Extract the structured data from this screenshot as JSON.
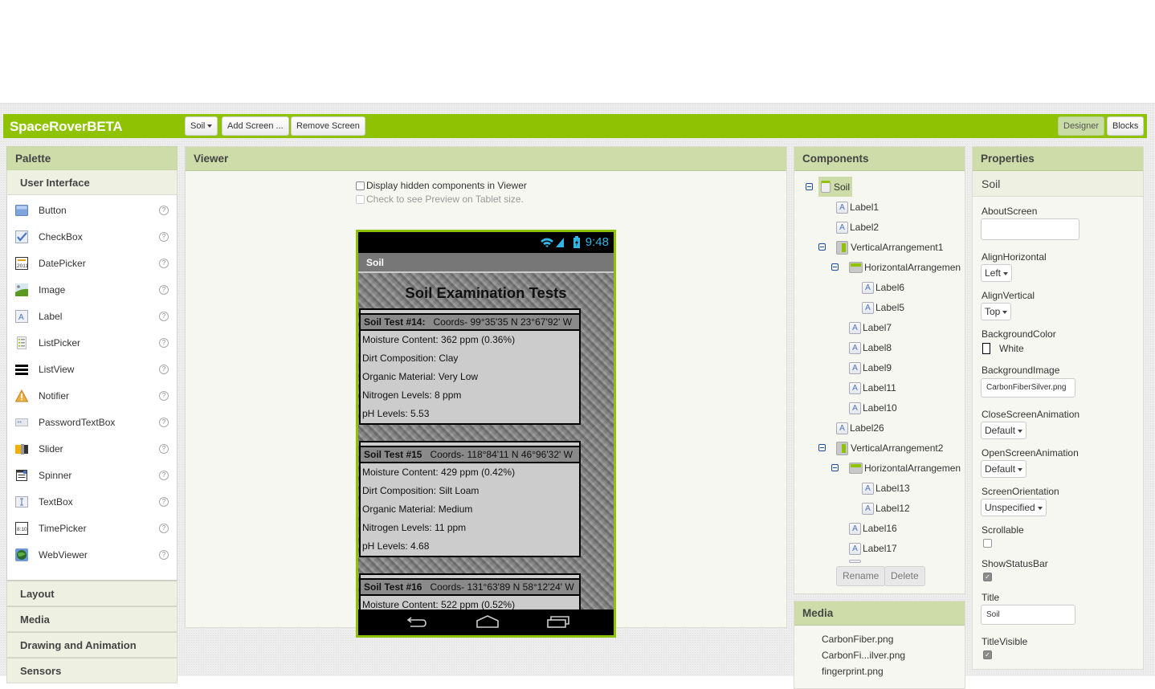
{
  "app": {
    "title": "SpaceRoverBETA"
  },
  "toolbar": {
    "screen_select": "Soil",
    "add_screen": "Add Screen ...",
    "remove_screen": "Remove Screen",
    "designer": "Designer",
    "blocks": "Blocks"
  },
  "palette": {
    "title": "Palette",
    "section": "User Interface",
    "items": [
      {
        "label": "Button",
        "icon": "button-icon"
      },
      {
        "label": "CheckBox",
        "icon": "checkbox-icon"
      },
      {
        "label": "DatePicker",
        "icon": "datepicker-icon"
      },
      {
        "label": "Image",
        "icon": "image-icon"
      },
      {
        "label": "Label",
        "icon": "label-icon"
      },
      {
        "label": "ListPicker",
        "icon": "listpicker-icon"
      },
      {
        "label": "ListView",
        "icon": "listview-icon"
      },
      {
        "label": "Notifier",
        "icon": "notifier-icon"
      },
      {
        "label": "PasswordTextBox",
        "icon": "password-icon"
      },
      {
        "label": "Slider",
        "icon": "slider-icon"
      },
      {
        "label": "Spinner",
        "icon": "spinner-icon"
      },
      {
        "label": "TextBox",
        "icon": "textbox-icon"
      },
      {
        "label": "TimePicker",
        "icon": "timepicker-icon"
      },
      {
        "label": "WebViewer",
        "icon": "webviewer-icon"
      }
    ],
    "help_glyph": "?",
    "categories": [
      "Layout",
      "Media",
      "Drawing and Animation",
      "Sensors"
    ]
  },
  "viewer": {
    "title": "Viewer",
    "display_hidden": "Display hidden components in Viewer",
    "tablet_preview": "Check to see Preview on Tablet size.",
    "phone": {
      "clock": "9:48",
      "screen_title": "Soil",
      "heading": "Soil Examination Tests",
      "tests": [
        {
          "name": "Soil Test #14:",
          "coords": "Coords- 99°35'35 N 23°67'92' W",
          "lines": [
            "Moisture Content: 362 ppm (0.36%)",
            "Dirt Composition: Clay",
            "Organic Material: Very Low",
            "Nitrogen Levels: 8 ppm",
            "pH Levels: 5.53"
          ]
        },
        {
          "name": "Soil Test #15",
          "coords": "Coords- 118°84'11 N 46°96'32' W",
          "lines": [
            "Moisture Content: 429 ppm (0.42%)",
            "Dirt Composition: Silt Loam",
            "Organic Material: Medium",
            "Nitrogen Levels: 11 ppm",
            "pH Levels: 4.68"
          ]
        },
        {
          "name": "Soil Test #16",
          "coords": "Coords- 131°63'89 N 58°12'24' W",
          "lines": [
            "Moisture Content: 522 ppm (0.52%)"
          ]
        }
      ]
    }
  },
  "components": {
    "title": "Components",
    "tree": [
      {
        "label": "Soil",
        "type": "screen"
      },
      {
        "label": "Label1",
        "type": "label"
      },
      {
        "label": "Label2",
        "type": "label"
      },
      {
        "label": "VerticalArrangement1",
        "type": "vertical"
      },
      {
        "label": "HorizontalArrangemen",
        "type": "horizontal"
      },
      {
        "label": "Label6",
        "type": "label"
      },
      {
        "label": "Label5",
        "type": "label"
      },
      {
        "label": "Label7",
        "type": "label"
      },
      {
        "label": "Label8",
        "type": "label"
      },
      {
        "label": "Label9",
        "type": "label"
      },
      {
        "label": "Label11",
        "type": "label"
      },
      {
        "label": "Label10",
        "type": "label"
      },
      {
        "label": "Label26",
        "type": "label"
      },
      {
        "label": "VerticalArrangement2",
        "type": "vertical"
      },
      {
        "label": "HorizontalArrangemen",
        "type": "horizontal"
      },
      {
        "label": "Label13",
        "type": "label"
      },
      {
        "label": "Label12",
        "type": "label"
      },
      {
        "label": "Label16",
        "type": "label"
      },
      {
        "label": "Label17",
        "type": "label"
      }
    ],
    "rename": "Rename",
    "delete": "Delete"
  },
  "media": {
    "title": "Media",
    "files": [
      "CarbonFiber.png",
      "CarbonFi...ilver.png",
      "fingerprint.png"
    ]
  },
  "properties": {
    "title": "Properties",
    "component": "Soil",
    "about_screen": {
      "label": "AboutScreen",
      "value": ""
    },
    "align_horizontal": {
      "label": "AlignHorizontal",
      "value": "Left"
    },
    "align_vertical": {
      "label": "AlignVertical",
      "value": "Top"
    },
    "background_color": {
      "label": "BackgroundColor",
      "value": "White",
      "swatch": "#ffffff"
    },
    "background_image": {
      "label": "BackgroundImage",
      "value": "CarbonFiberSilver.png"
    },
    "close_anim": {
      "label": "CloseScreenAnimation",
      "value": "Default"
    },
    "open_anim": {
      "label": "OpenScreenAnimation",
      "value": "Default"
    },
    "orientation": {
      "label": "ScreenOrientation",
      "value": "Unspecified"
    },
    "scrollable": {
      "label": "Scrollable",
      "checked": false
    },
    "show_status_bar": {
      "label": "ShowStatusBar",
      "checked": true
    },
    "title_prop": {
      "label": "Title",
      "value": "Soil"
    },
    "title_visible": {
      "label": "TitleVisible",
      "checked": true
    }
  },
  "colors": {
    "accent": "#8fc202",
    "panel_header": "#cddca9",
    "clock": "#33b5e5"
  }
}
